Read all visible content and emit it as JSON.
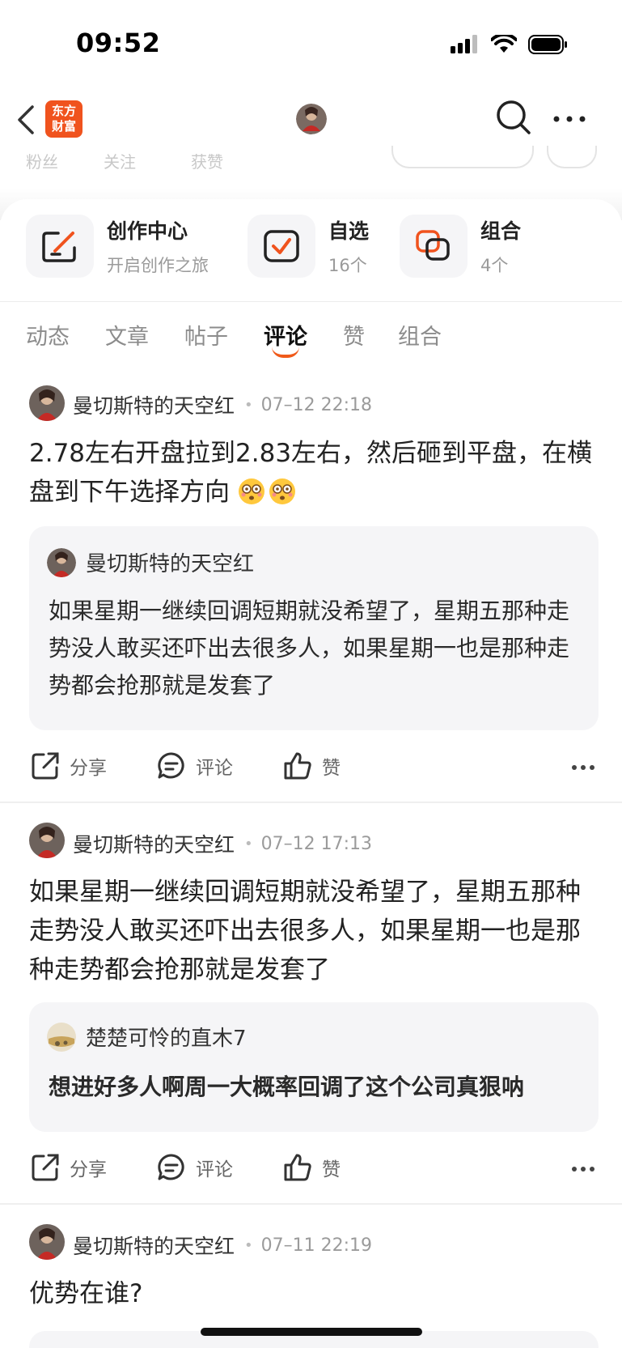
{
  "status": {
    "time": "09:52"
  },
  "header": {
    "logo_line1": "东方",
    "logo_line2": "财富"
  },
  "faded_stats": {
    "fans": "粉丝",
    "follow": "关注",
    "likes": "获赞"
  },
  "quick_actions": [
    {
      "title": "创作中心",
      "sub": "开启创作之旅"
    },
    {
      "title": "自选",
      "sub": "16个"
    },
    {
      "title": "组合",
      "sub": "4个"
    }
  ],
  "tabs": [
    "动态",
    "文章",
    "帖子",
    "评论",
    "赞",
    "组合"
  ],
  "active_tab": "评论",
  "actions": {
    "share": "分享",
    "comment": "评论",
    "like": "赞"
  },
  "posts": [
    {
      "author": "曼切斯特的天空红",
      "time": "07–12 22:18",
      "text": "2.78左右开盘拉到2.83左右，然后砸到平盘，在横盘到下午选择方向",
      "quote": {
        "author": "曼切斯特的天空红",
        "text": "如果星期一继续回调短期就没希望了，星期五那种走势没人敢买还吓出去很多人，如果星期一也是那种走势都会抢那就是发套了"
      }
    },
    {
      "author": "曼切斯特的天空红",
      "time": "07–12 17:13",
      "text": "如果星期一继续回调短期就没希望了，星期五那种走势没人敢买还吓出去很多人，如果星期一也是那种走势都会抢那就是发套了",
      "quote": {
        "author": "楚楚可怜的直木7",
        "text": "想进好多人啊周一大概率回调了这个公司真狠呐"
      }
    },
    {
      "author": "曼切斯特的天空红",
      "time": "07–11 22:19",
      "text": "优势在谁?"
    }
  ]
}
